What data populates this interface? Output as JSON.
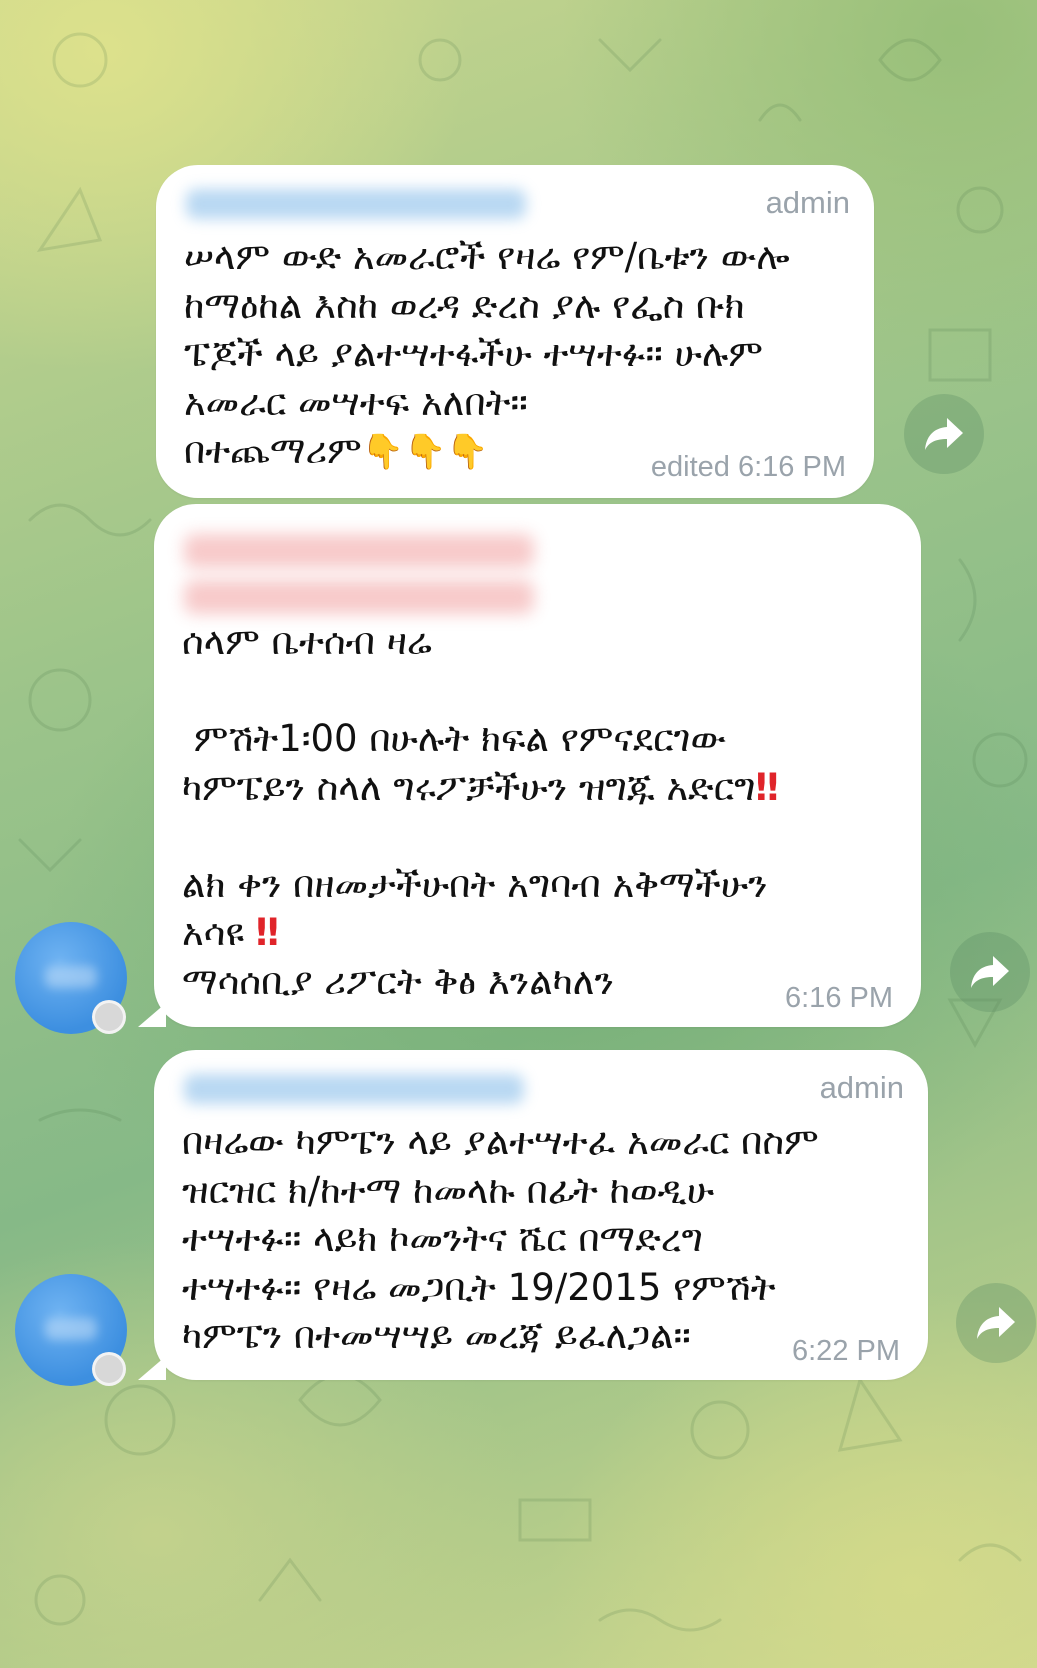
{
  "chat": {
    "messages": [
      {
        "role": "admin",
        "lines": [
          "ሠላም ውድ አመራሮች የዛሬ የም/ቤቱን ውሎ",
          "ከማዕከል እስከ ወረዳ ድረስ ያሉ የፌስ ቡክ",
          "ፔጆች ላይ ያልተሣተፋችሁ ተሣተፉ። ሁሉም",
          "አመራር መሣተፍ አለበት።"
        ],
        "last_line": "በተጨማሪም",
        "emoji": "👇👇👇",
        "time": "edited 6:16 PM"
      },
      {
        "role": "",
        "lines": [
          "ሰላም ቤተሰብ ዛሬ",
          "",
          " ምሽት1፡00 በሁሉት ክፍል የምናደርገው",
          "ካምፔይን ስላለ ግሩፖቻችሁን ዝግጁ አድርግ"
        ],
        "bang1": "‼",
        "lines_b": [
          "",
          "ልክ ቀን በዘመታችሁበት አግባብ አቅማችሁን"
        ],
        "line_c": "አሳዩ ",
        "bang2": "‼",
        "line_d": "ማሳሰቢያ ሪፖርት ቅፅ እንልካለን",
        "time": "6:16 PM"
      },
      {
        "role": "admin",
        "lines": [
          "በዛሬው ካምፔን ላይ ያልተሣተፈ አመራር በስም",
          "ዝርዝር ክ/ከተማ ከመላኩ በፊት ከወዲሁ",
          "ተሣተፉ። ላይክ ኮመንትና ሼር በማድረግ",
          "ተሣተፉ። የዛሬ መጋቢት 19/2015 የምሽት",
          "ካምፔን በተመሣሣይ መረጃ ይፈለጋል።"
        ],
        "time": "6:22 PM"
      }
    ]
  },
  "icons": {
    "share": "share-arrow-icon",
    "avatar": "user-avatar",
    "emoji": "backhand-index-pointing-down",
    "bang": "double-exclamation-mark"
  },
  "colors": {
    "bubble": "#ffffff",
    "meta_text": "#9aa3ab",
    "body_text": "#111111",
    "avatar": "#4a9ae6",
    "bang": "#e0242a",
    "emoji": "#f1b323"
  }
}
